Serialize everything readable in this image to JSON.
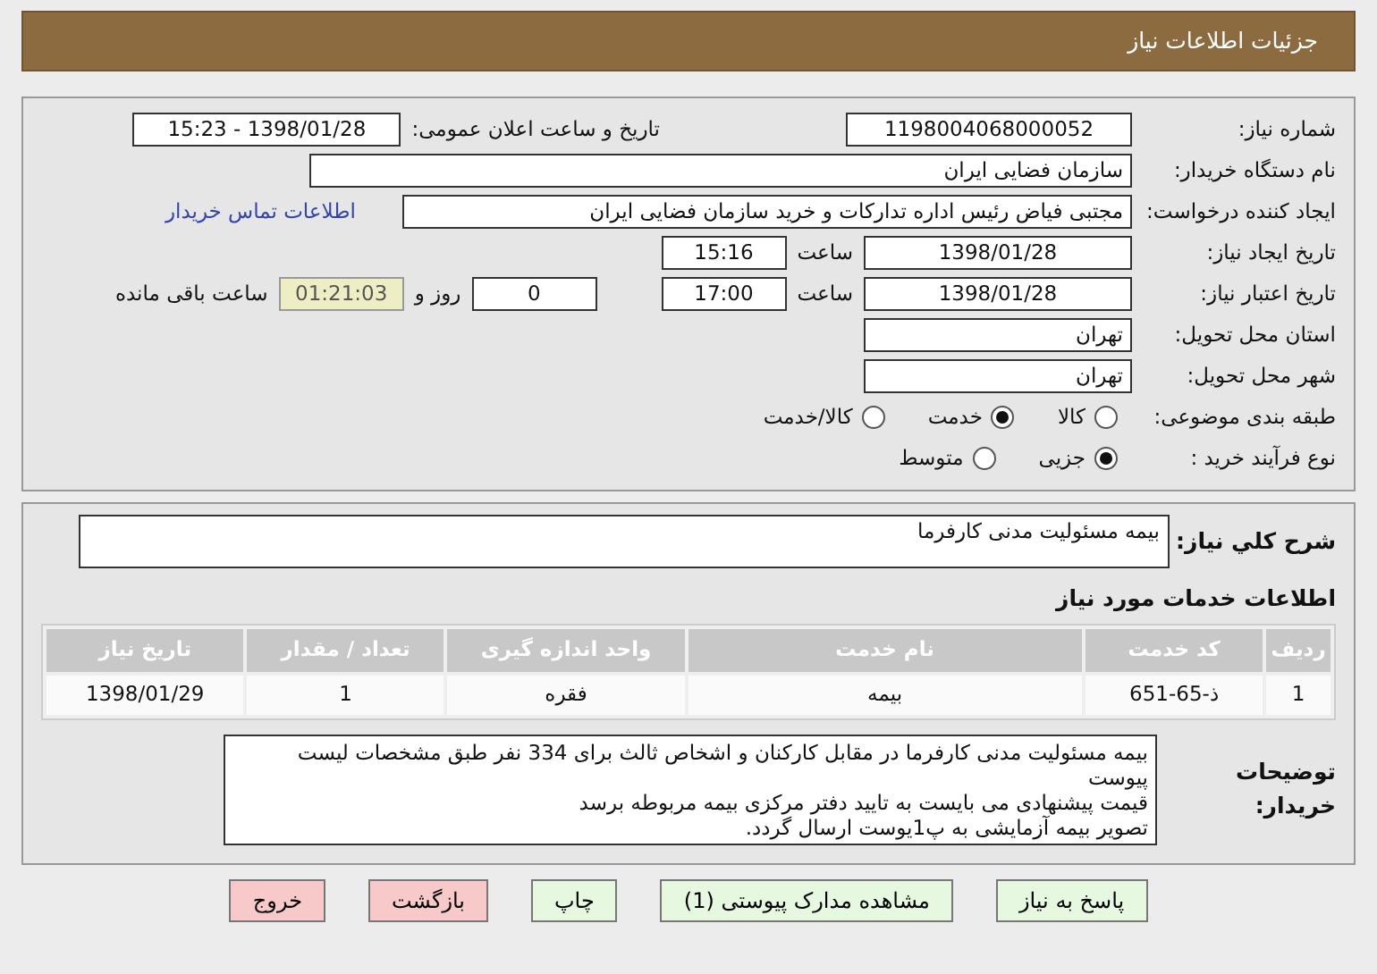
{
  "header": {
    "title": "جزئیات اطلاعات نیاز"
  },
  "need_number": {
    "label": "شماره نیاز:",
    "value": "1198004068000052"
  },
  "announce": {
    "label": "تاریخ و ساعت اعلان عمومی:",
    "value": "1398/01/28 - 15:23"
  },
  "buyer": {
    "label": "نام دستگاه خریدار:",
    "value": "سازمان فضایی ایران"
  },
  "requester": {
    "label": "ایجاد کننده درخواست:",
    "value": "مجتبی  فیاض رئیس اداره تدارکات و خرید سازمان فضایی ایران",
    "link": "اطلاعات تماس خریدار"
  },
  "created": {
    "label": "تاریخ ایجاد نیاز:",
    "date": "1398/01/28",
    "time_label": "ساعت",
    "time": "15:16"
  },
  "validity": {
    "label": "تاریخ اعتبار نیاز:",
    "date": "1398/01/28",
    "time_label": "ساعت",
    "time": "17:00",
    "days": "0",
    "days_label": "روز و",
    "remaining": "01:21:03",
    "remaining_label": "ساعت باقی مانده"
  },
  "province": {
    "label": "استان محل تحویل:",
    "value": "تهران"
  },
  "city": {
    "label": "شهر محل تحویل:",
    "value": "تهران"
  },
  "category": {
    "label": "طبقه بندی موضوعی:",
    "options": [
      {
        "label": "کالا",
        "selected": false
      },
      {
        "label": "خدمت",
        "selected": true
      },
      {
        "label": "کالا/خدمت",
        "selected": false
      }
    ]
  },
  "process": {
    "label": "نوع فرآیند خرید :",
    "options": [
      {
        "label": "جزیی",
        "selected": true
      },
      {
        "label": "متوسط",
        "selected": false
      }
    ]
  },
  "description": {
    "label": "شرح کلي نياز:",
    "value": "بیمه مسئولیت مدنی کارفرما"
  },
  "services": {
    "title": "اطلاعات خدمات مورد نیاز",
    "columns": [
      "ردیف",
      "کد خدمت",
      "نام خدمت",
      "واحد اندازه گیری",
      "تعداد / مقدار",
      "تاریخ نیاز"
    ],
    "rows": [
      [
        "1",
        "ذ-65-651",
        "بیمه",
        "فقره",
        "1",
        "1398/01/29"
      ]
    ]
  },
  "buyer_notes": {
    "label": "توضیحات خریدار:",
    "lines": [
      "بیمه مسئولیت مدنی کارفرما در مقابل کارکنان و اشخاص ثالث برای 334 نفر طبق مشخصات لیست پیوست",
      "قیمت پیشنهادی می بایست به تایید دفتر مرکزی بیمه مربوطه برسد",
      "تصویر بیمه آزمایشی به پ1یوست ارسال گردد."
    ]
  },
  "buttons": [
    {
      "label": "پاسخ به نیاز",
      "kind": "primary"
    },
    {
      "label": "مشاهده مدارک پیوستی (1)",
      "kind": "primary"
    },
    {
      "label": "چاپ",
      "kind": "primary"
    },
    {
      "label": "بازگشت",
      "kind": "danger"
    },
    {
      "label": "خروج",
      "kind": "danger"
    }
  ]
}
